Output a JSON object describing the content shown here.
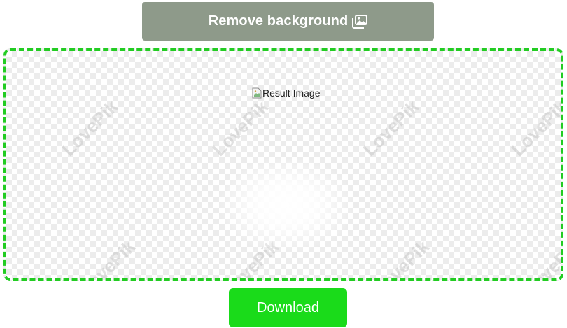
{
  "toolbar": {
    "remove_label": "Remove background",
    "remove_icon": "images-icon"
  },
  "result": {
    "image_alt": "Result Image",
    "broken_icon": "broken-image-icon",
    "border_color": "#22cc22",
    "watermark_text": "LovePik"
  },
  "actions": {
    "download_label": "Download",
    "download_color": "#1adb1a"
  },
  "colors": {
    "remove_button": "#8e9a8a"
  }
}
